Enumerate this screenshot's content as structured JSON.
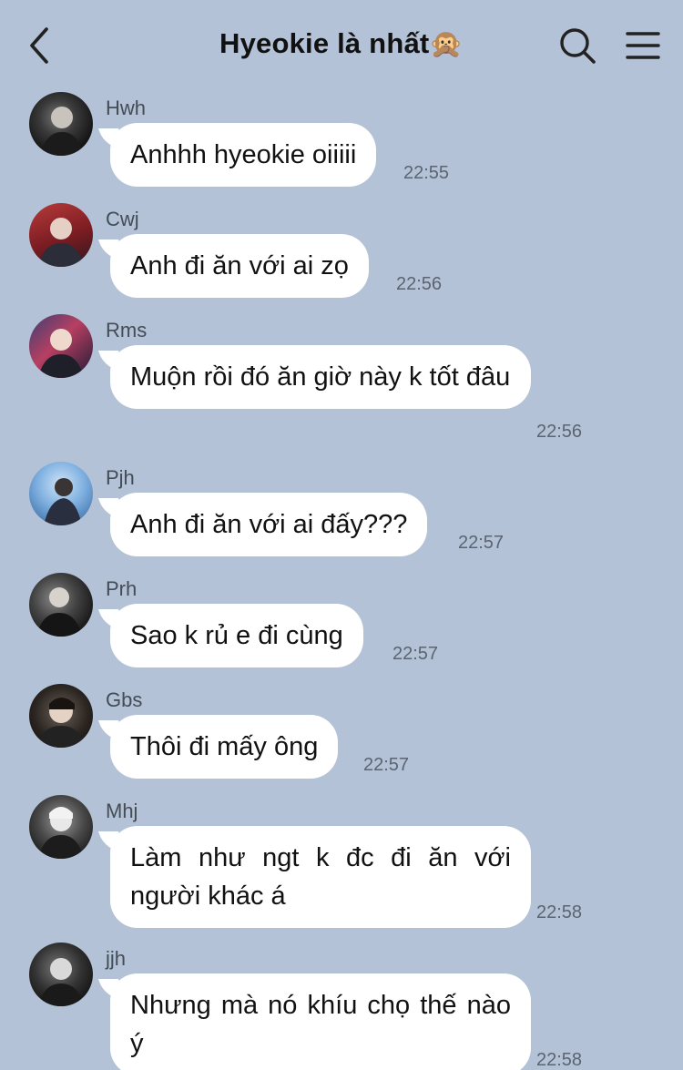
{
  "header": {
    "title": "Hyeokie là nhất",
    "title_emoji": "🙊"
  },
  "icons": {
    "back": "chevron-left-icon",
    "search": "search-icon",
    "menu": "hamburger-menu-icon"
  },
  "messages": [
    {
      "sender": "Hwh",
      "text": "Anhhh hyeokie oiiiii",
      "time": "22:55"
    },
    {
      "sender": "Cwj",
      "text": "Anh đi ăn với ai zọ",
      "time": "22:56"
    },
    {
      "sender": "Rms",
      "text": "Muộn rồi đó ăn giờ này k tốt đâu",
      "time": "22:56"
    },
    {
      "sender": "Pjh",
      "text": "Anh đi ăn với ai đấy???",
      "time": "22:57"
    },
    {
      "sender": "Prh",
      "text": "Sao k rủ e đi cùng",
      "time": "22:57"
    },
    {
      "sender": "Gbs",
      "text": "Thôi đi mấy ông",
      "time": "22:57"
    },
    {
      "sender": "Mhj",
      "text": "Làm như ngt k đc đi ăn với người khác á",
      "time": "22:58"
    },
    {
      "sender": "jjh",
      "text": "Nhưng mà nó khíu chọ thế nào ý",
      "time": "22:58"
    }
  ],
  "colors": {
    "background": "#b3c2d6",
    "bubble": "#ffffff",
    "text": "#111111",
    "meta": "#5b6470"
  }
}
